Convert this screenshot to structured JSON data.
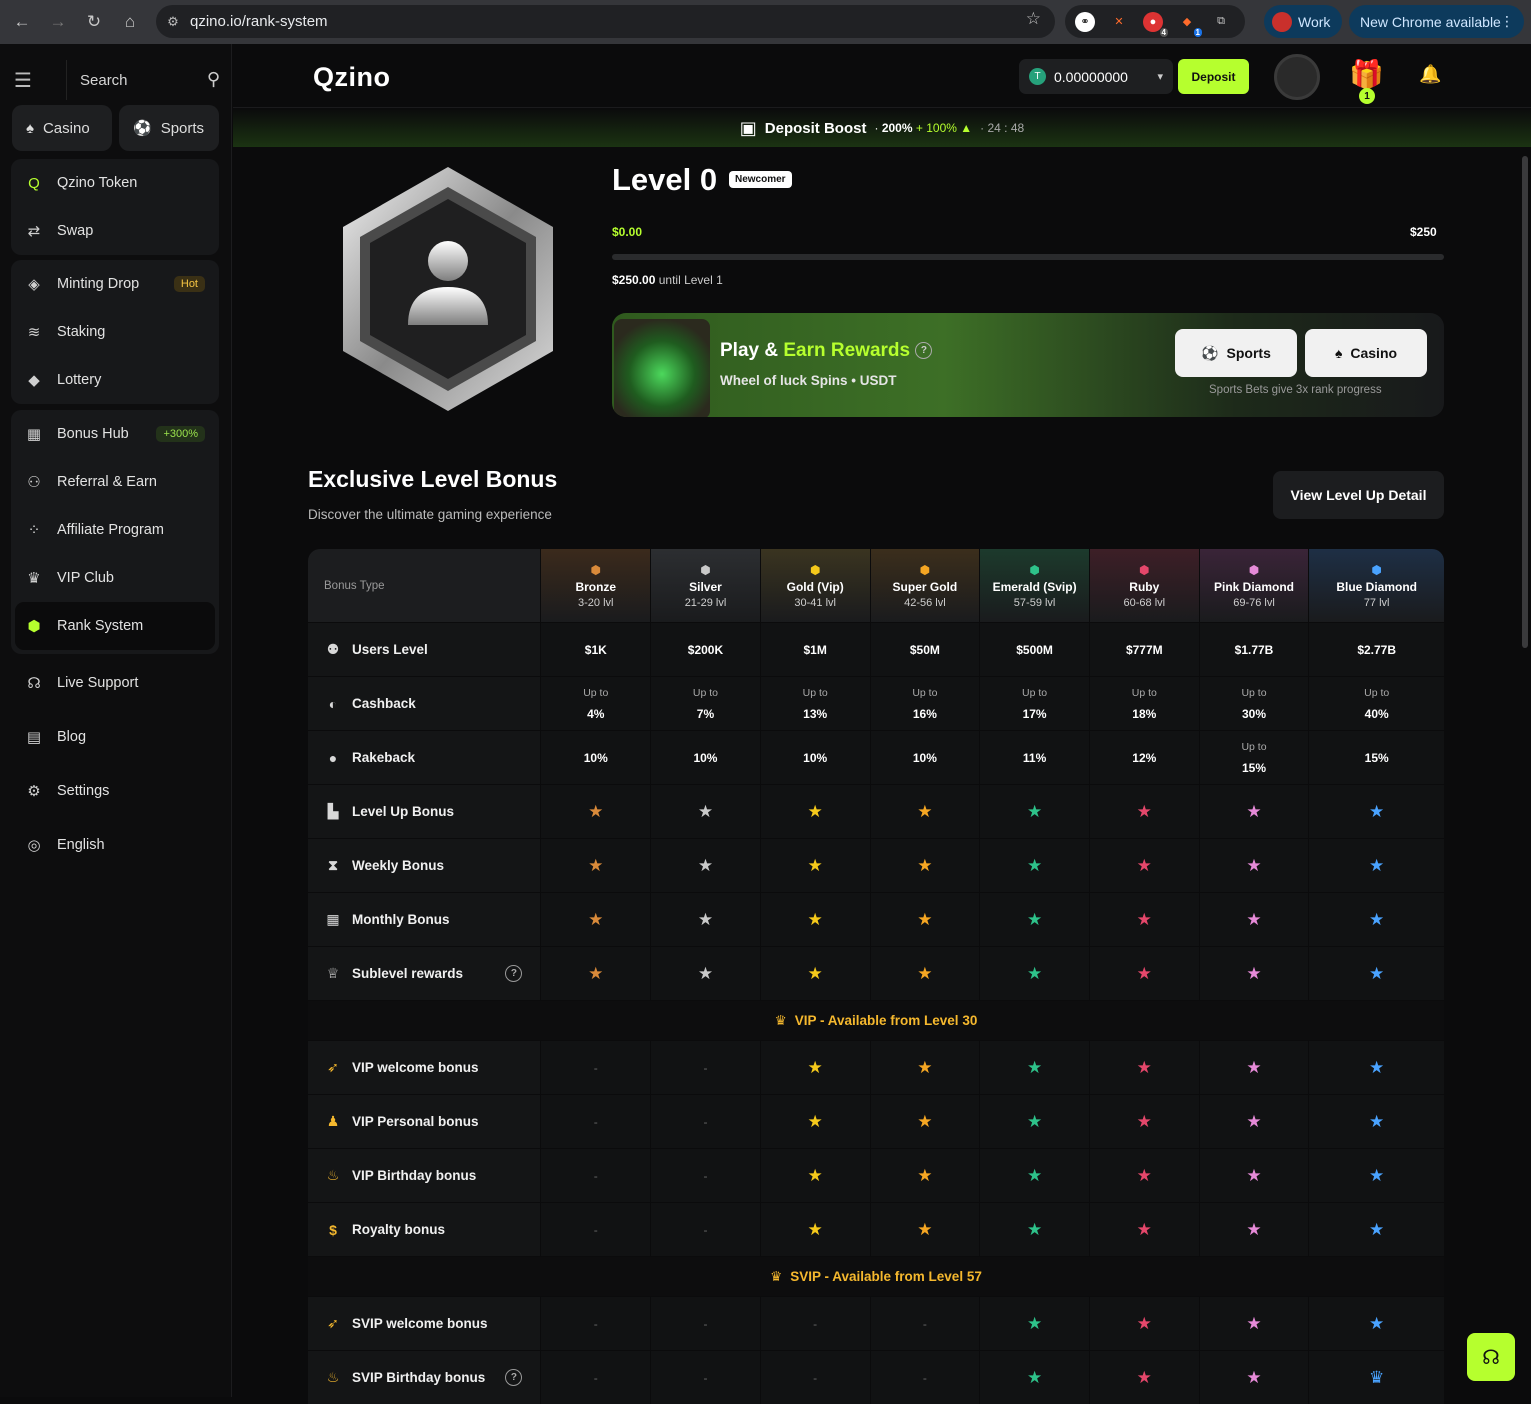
{
  "browser": {
    "url": "qzino.io/rank-system",
    "profile_label": "Work",
    "update_label": "New Chrome available",
    "ext_badges": [
      "4",
      "1"
    ]
  },
  "sidebar": {
    "search_label": "Search",
    "casino_label": "Casino",
    "sports_label": "Sports",
    "group1": [
      {
        "label": "Qzino Token",
        "icon": "qzino-icon"
      },
      {
        "label": "Swap",
        "icon": "swap-icon"
      }
    ],
    "group2": [
      {
        "label": "Minting Drop",
        "icon": "diamond-icon",
        "tag": "Hot"
      },
      {
        "label": "Staking",
        "icon": "coins-icon"
      },
      {
        "label": "Lottery",
        "icon": "ticket-icon"
      }
    ],
    "group3": [
      {
        "label": "Bonus Hub",
        "icon": "gift-icon",
        "tag": "+300%"
      },
      {
        "label": "Referral & Earn",
        "icon": "users-icon"
      },
      {
        "label": "Affiliate Program",
        "icon": "network-icon"
      },
      {
        "label": "VIP Club",
        "icon": "crown-icon"
      },
      {
        "label": "Rank System",
        "icon": "rank-icon"
      }
    ],
    "loose": [
      {
        "label": "Live Support",
        "icon": "headset-icon"
      },
      {
        "label": "Blog",
        "icon": "blog-icon"
      },
      {
        "label": "Settings",
        "icon": "gear-icon"
      },
      {
        "label": "English",
        "icon": "globe-icon"
      }
    ]
  },
  "topbar": {
    "logo": "Qzino",
    "balance": "0.00000000",
    "deposit_label": "Deposit",
    "gift_count": "1"
  },
  "boost": {
    "title": "Deposit Boost",
    "pct_a": "200%",
    "plus": "+",
    "pct_b": "100%",
    "timer": "24 : 48"
  },
  "level": {
    "title": "Level 0",
    "badge": "Newcomer",
    "start": "$0.00",
    "end": "$250",
    "progress": 0,
    "until_amount": "$250.00",
    "until_text": "until Level 1"
  },
  "promo": {
    "title_a": "Play &",
    "title_b": "Earn Rewards",
    "subtitle": "Wheel of luck Spins  •  USDT",
    "sports_label": "Sports",
    "casino_label": "Casino",
    "note": "Sports Bets give 3x rank progress"
  },
  "section": {
    "title": "Exclusive Level Bonus",
    "subtitle": "Discover the ultimate gaming experience",
    "view_button": "View Level Up Detail"
  },
  "table": {
    "first_header": "Bonus Type",
    "tiers": [
      {
        "name": "Bronze",
        "range": "3-20 lvl",
        "color": "#d98a3a",
        "bg": "#3b2a1c"
      },
      {
        "name": "Silver",
        "range": "21-29 lvl",
        "color": "#c9c9c9",
        "bg": "#2c2e31"
      },
      {
        "name": "Gold (Vip)",
        "range": "30-41 lvl",
        "color": "#f5c91b",
        "bg": "#3a3420"
      },
      {
        "name": "Super Gold",
        "range": "42-56 lvl",
        "color": "#f5a623",
        "bg": "#3b2e1c"
      },
      {
        "name": "Emerald (Svip)",
        "range": "57-59 lvl",
        "color": "#2ec28a",
        "bg": "#1c3a2c"
      },
      {
        "name": "Ruby",
        "range": "60-68 lvl",
        "color": "#e5476b",
        "bg": "#3d1f27"
      },
      {
        "name": "Pink Diamond",
        "range": "69-76 lvl",
        "color": "#e68ad8",
        "bg": "#3a2438"
      },
      {
        "name": "Blue Diamond",
        "range": "77 lvl",
        "color": "#4aa3ff",
        "bg": "#1e2f45"
      }
    ],
    "up_to": "Up to",
    "dash": "-",
    "rows_a": [
      {
        "label": "Users Level",
        "icon": "user-level-icon",
        "cells": [
          {
            "v": "$1K"
          },
          {
            "v": "$200K"
          },
          {
            "v": "$1M"
          },
          {
            "v": "$50M"
          },
          {
            "v": "$500M"
          },
          {
            "v": "$777M"
          },
          {
            "v": "$1.77B"
          },
          {
            "v": "$2.77B"
          }
        ]
      },
      {
        "label": "Cashback",
        "icon": "cashback-icon",
        "cells": [
          {
            "v": "4%",
            "up": true
          },
          {
            "v": "7%",
            "up": true
          },
          {
            "v": "13%",
            "up": true
          },
          {
            "v": "16%",
            "up": true
          },
          {
            "v": "17%",
            "up": true
          },
          {
            "v": "18%",
            "up": true
          },
          {
            "v": "30%",
            "up": true
          },
          {
            "v": "40%",
            "up": true
          }
        ]
      },
      {
        "label": "Rakeback",
        "icon": "rakeback-icon",
        "cells": [
          {
            "v": "10%"
          },
          {
            "v": "10%"
          },
          {
            "v": "10%"
          },
          {
            "v": "10%"
          },
          {
            "v": "11%"
          },
          {
            "v": "12%"
          },
          {
            "v": "15%",
            "up": true
          },
          {
            "v": "15%"
          }
        ]
      },
      {
        "label": "Level Up Bonus",
        "icon": "podium-icon",
        "cells": [
          "s",
          "s",
          "s",
          "s",
          "s",
          "s",
          "s",
          "s"
        ]
      },
      {
        "label": "Weekly Bonus",
        "icon": "hourglass-icon",
        "cells": [
          "s",
          "s",
          "s",
          "s",
          "s",
          "s",
          "s",
          "s"
        ]
      },
      {
        "label": "Monthly Bonus",
        "icon": "calendar-icon",
        "cells": [
          "s",
          "s",
          "s",
          "s",
          "s",
          "s",
          "s",
          "s"
        ]
      },
      {
        "label": "Sublevel rewards",
        "icon": "trophy-icon",
        "help": true,
        "cells": [
          "s",
          "s",
          "s",
          "s",
          "s",
          "s",
          "s",
          "s"
        ]
      }
    ],
    "vip_band": "VIP - Available from Level 30",
    "rows_b": [
      {
        "label": "VIP welcome bonus",
        "icon": "rocket-icon",
        "cells": [
          "-",
          "-",
          "s",
          "s",
          "s",
          "s",
          "s",
          "s"
        ]
      },
      {
        "label": "VIP Personal bonus",
        "icon": "person-icon",
        "cells": [
          "-",
          "-",
          "s",
          "s",
          "s",
          "s",
          "s",
          "s"
        ]
      },
      {
        "label": "VIP Birthday bonus",
        "icon": "cake-icon",
        "cells": [
          "-",
          "-",
          "s",
          "s",
          "s",
          "s",
          "s",
          "s"
        ]
      },
      {
        "label": "Royalty bonus",
        "icon": "dollar-coin-icon",
        "cells": [
          "-",
          "-",
          "s",
          "s",
          "s",
          "s",
          "s",
          "s"
        ]
      }
    ],
    "svip_band": "SVIP - Available from Level 57",
    "rows_c": [
      {
        "label": "SVIP welcome bonus",
        "icon": "rocket-icon",
        "cells": [
          "-",
          "-",
          "-",
          "-",
          "s",
          "s",
          "s",
          "s"
        ]
      },
      {
        "label": "SVIP Birthday bonus",
        "icon": "cake-icon",
        "help": true,
        "cells": [
          "-",
          "-",
          "-",
          "-",
          "s",
          "s",
          "s",
          "c"
        ]
      }
    ]
  },
  "accent": "#b6ff2e"
}
